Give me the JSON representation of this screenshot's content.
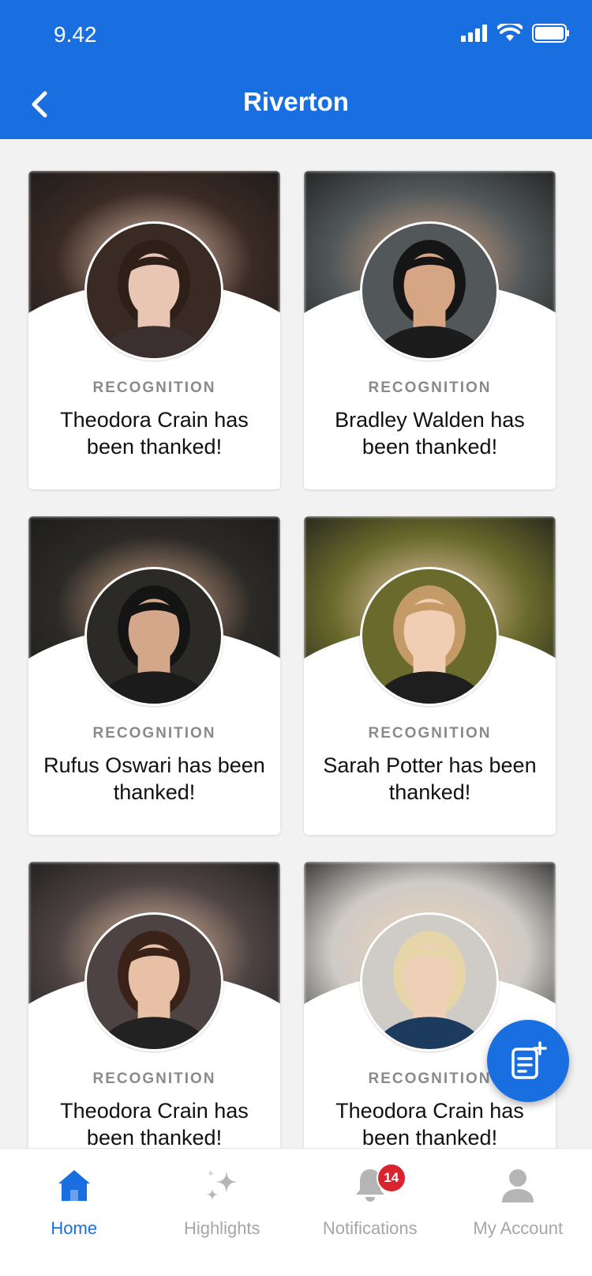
{
  "status_bar": {
    "time": "9.42"
  },
  "header": {
    "title": "Riverton",
    "back_icon": "chevron-left-icon"
  },
  "colors": {
    "primary": "#1a6fe0",
    "badge": "#d9232e",
    "background": "#f2f2f2"
  },
  "cards": [
    {
      "label": "RECOGNITION",
      "text": "Theodora Crain has been thanked!",
      "bg": "#3a2a24",
      "skin": "#e9c6b3",
      "hair": "#2e1f18",
      "shirt": "#3b2f2f"
    },
    {
      "label": "RECOGNITION",
      "text": "Bradley Walden has been thanked!",
      "bg": "#52585a",
      "skin": "#d6a684",
      "hair": "#151515",
      "shirt": "#1c1c1c"
    },
    {
      "label": "RECOGNITION",
      "text": "Rufus Oswari has been thanked!",
      "bg": "#2c2a26",
      "skin": "#d4a68a",
      "hair": "#141414",
      "shirt": "#1b1b1b"
    },
    {
      "label": "RECOGNITION",
      "text": "Sarah Potter has been thanked!",
      "bg": "#6a6a2c",
      "skin": "#f1cdb4",
      "hair": "#c49a67",
      "shirt": "#1e1e1e"
    },
    {
      "label": "RECOGNITION",
      "text": "Theodora Crain has been thanked!",
      "bg": "#4d4342",
      "skin": "#e7c0a6",
      "hair": "#3a2218",
      "shirt": "#222"
    },
    {
      "label": "RECOGNITION",
      "text": "Theodora Crain has been thanked!",
      "bg": "#cfcbc6",
      "skin": "#efd0b6",
      "hair": "#e6d5a9",
      "shirt": "#1d3a5f"
    }
  ],
  "fab": {
    "icon": "new-post-icon"
  },
  "bottom_nav": [
    {
      "label": "Home",
      "icon": "home-icon",
      "active": true
    },
    {
      "label": "Highlights",
      "icon": "sparkle-icon",
      "active": false
    },
    {
      "label": "Notifications",
      "icon": "bell-icon",
      "active": false,
      "badge": "14"
    },
    {
      "label": "My Account",
      "icon": "person-icon",
      "active": false
    }
  ]
}
